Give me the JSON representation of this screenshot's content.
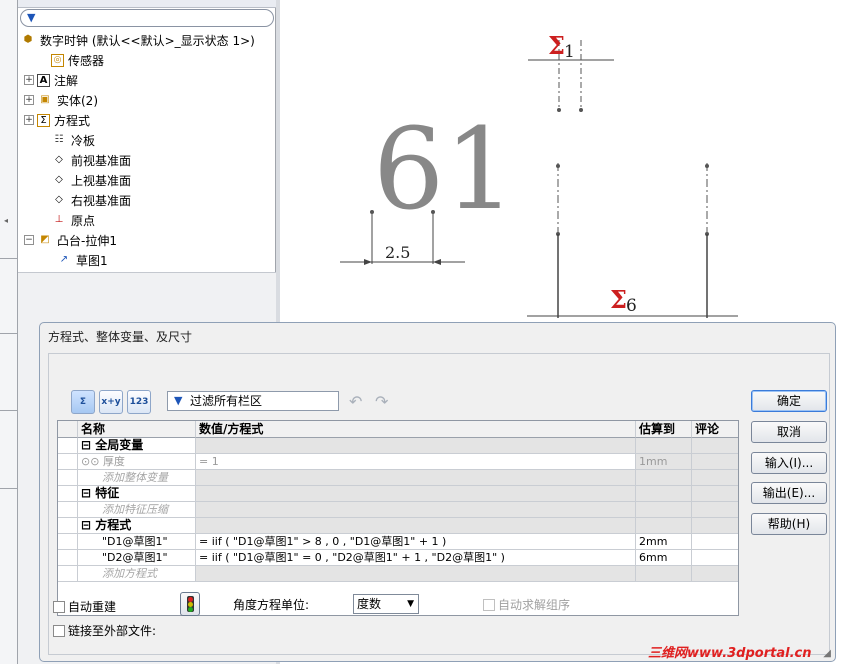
{
  "tree": {
    "root_label": "数字时钟 (默认<<默认>_显示状态 1>)",
    "items": [
      {
        "label": "传感器",
        "icon": "sensor-icon",
        "expander": ""
      },
      {
        "label": "注解",
        "icon": "annotation-icon",
        "expander": "+"
      },
      {
        "label": "实体(2)",
        "icon": "solid-bodies-icon",
        "expander": "+"
      },
      {
        "label": "方程式",
        "icon": "equations-icon",
        "expander": "+"
      },
      {
        "label": "冷板",
        "icon": "material-icon",
        "expander": ""
      },
      {
        "label": "前视基准面",
        "icon": "plane-icon",
        "expander": ""
      },
      {
        "label": "上视基准面",
        "icon": "plane-icon",
        "expander": ""
      },
      {
        "label": "右视基准面",
        "icon": "plane-icon",
        "expander": ""
      },
      {
        "label": "原点",
        "icon": "origin-icon",
        "expander": ""
      },
      {
        "label": "凸台-拉伸1",
        "icon": "extrude-icon",
        "expander": "−"
      },
      {
        "label": "草图1",
        "icon": "sketch-icon",
        "expander": ""
      }
    ]
  },
  "graphics": {
    "number_text": "61",
    "dim_small": "2.5",
    "sigma_top_sub": "1",
    "sigma_bottom_sub": "6",
    "sigma_symbol": "Σ"
  },
  "dialog": {
    "title": "方程式、整体变量、及尺寸",
    "filter_text": "过滤所有栏区",
    "toolbar": [
      "Σ",
      "x+y",
      "123"
    ],
    "columns": [
      "名称",
      "数值/方程式",
      "估算到",
      "评论"
    ],
    "sections": {
      "globals": "全局变量",
      "features": "特征",
      "equations": "方程式"
    },
    "global_row": {
      "name": "厚度",
      "value": "= 1",
      "eval": "1mm"
    },
    "add_global": "添加整体变量",
    "add_feature": "添加特征压缩",
    "equations": [
      {
        "name": "\"D1@草图1\"",
        "value": "= iif ( \"D1@草图1\" > 8 , 0 , \"D1@草图1\" + 1 )",
        "eval": "2mm"
      },
      {
        "name": "\"D2@草图1\"",
        "value": "= iif ( \"D1@草图1\" = 0 , \"D2@草图1\" + 1 , \"D2@草图1\" )",
        "eval": "6mm"
      }
    ],
    "add_equation": "添加方程式",
    "buttons": {
      "ok": "确定",
      "cancel": "取消",
      "import": "输入(I)...",
      "export": "输出(E)...",
      "help": "帮助(H)"
    },
    "auto_rebuild": "自动重建",
    "angle_unit_label": "角度方程单位:",
    "angle_unit_value": "度数",
    "auto_solve": "自动求解组序",
    "link_external": "链接至外部文件:"
  },
  "watermark": "三维网www.3dportal.cn",
  "colors": {
    "accent": "#3b7bd9",
    "sigma": "#cc1f1f",
    "digits": "#888888"
  }
}
